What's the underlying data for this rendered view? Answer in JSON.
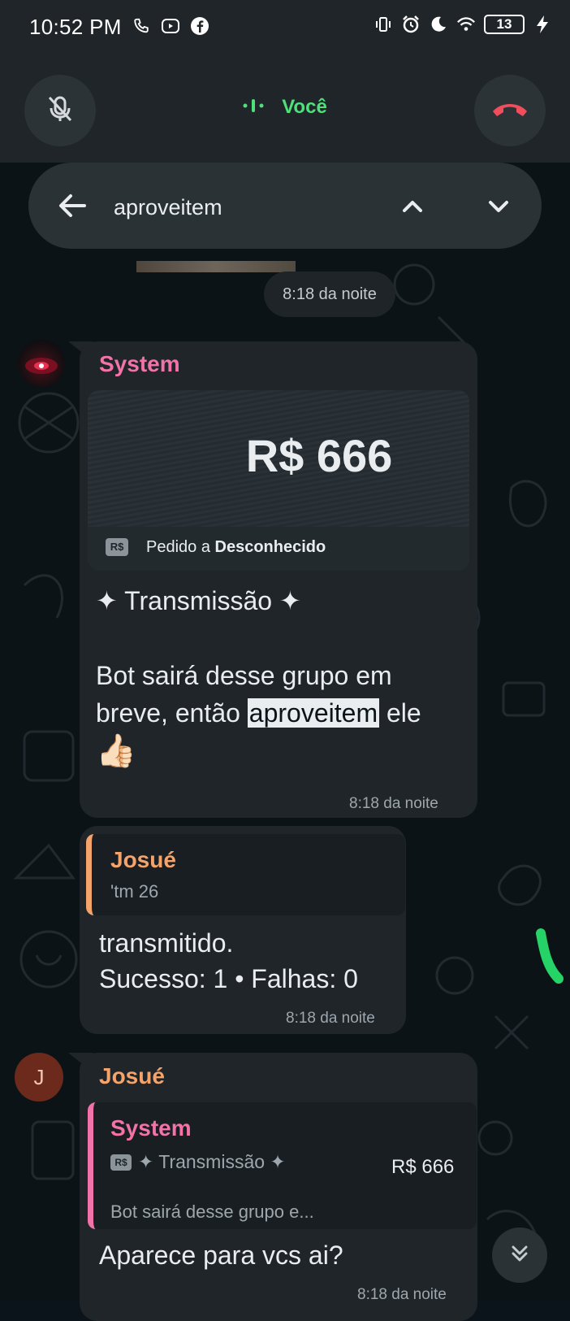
{
  "status_bar": {
    "time": "10:52 PM",
    "left_icons": [
      "phone-icon",
      "youtube-icon",
      "facebook-icon"
    ],
    "right_icons": [
      "vibrate-icon",
      "alarm-icon",
      "moon-icon",
      "wifi-icon",
      "battery-icon",
      "charging-icon"
    ],
    "battery": "13"
  },
  "call_bar": {
    "label": "Você",
    "accent_color": "#4fe07b",
    "end_color": "#f04d5d"
  },
  "search": {
    "query": "aproveitem"
  },
  "chat": {
    "date_chip": "8:18 da noite",
    "messages": [
      {
        "sender": "System",
        "sender_color": "#f273a7",
        "payment": {
          "amount": "R$ 666",
          "badge": "R$",
          "desc_prefix": "Pedido a",
          "desc_name": "Desconhecido"
        },
        "title": "✦ Transmissão ✦",
        "body_before": "Bot sairá desse grupo em breve, então ",
        "body_highlight": "aproveitem",
        "body_after": " ele",
        "emoji": "👍🏻",
        "time": "8:18 da noite"
      },
      {
        "quote": {
          "name": "Josué",
          "text": "'tm 26",
          "color": "#f4a36b"
        },
        "line1": "transmitido.",
        "line2": "Sucesso: 1 • Falhas: 0",
        "time": "8:18 da noite"
      },
      {
        "avatar_letter": "J",
        "sender": "Josué",
        "sender_color": "#f4a36b",
        "quote": {
          "name": "System",
          "badge": "R$",
          "line": "✦ Transmissão ✦",
          "amount": "R$ 666",
          "preview": "Bot sairá desse grupo e..."
        },
        "text": "Aparece para vcs ai?",
        "time": "8:18 da noite"
      }
    ]
  }
}
